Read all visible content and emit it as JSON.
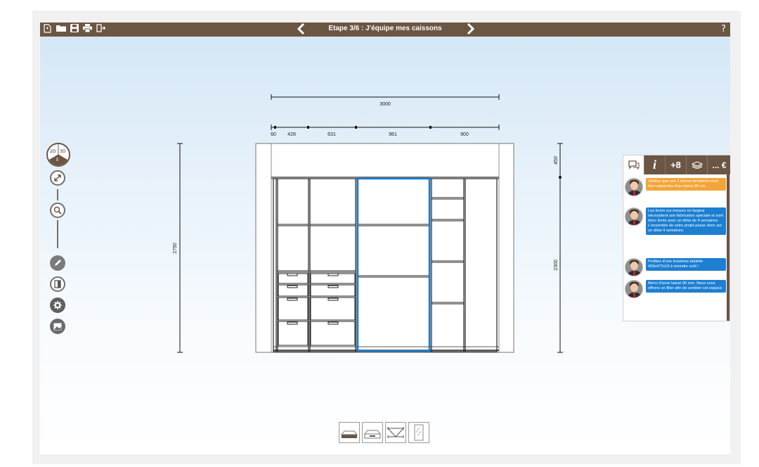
{
  "topbar": {
    "title": "Etape 3/6 : J'équipe mes caissons",
    "prev_icon": "chevron-left-icon",
    "next_icon": "chevron-right-icon",
    "help_label": "?",
    "file_icons": [
      "new-file-icon",
      "open-folder-icon",
      "save-icon",
      "print-icon",
      "exit-icon"
    ]
  },
  "tools": {
    "view_modes": {
      "mode_2d": "2D",
      "mode_3d": "3D",
      "mode_e": "E"
    },
    "items": [
      "view-mode-selector",
      "fit-view-icon",
      "zoom-icon",
      "pencil-icon",
      "door-icon",
      "settings-gear-icon",
      "photo-icon"
    ]
  },
  "dimensions": {
    "total_width": "3000",
    "segments": [
      "60",
      "428",
      "631",
      "981",
      "900"
    ],
    "total_height": "2750",
    "top_height": "450",
    "lower_height": "2300"
  },
  "panel": {
    "tabs": [
      {
        "icon": "chat-icon",
        "label": ""
      },
      {
        "icon": "info-icon",
        "label": "i"
      },
      {
        "icon": "add-user-icon",
        "label": "+8"
      },
      {
        "icon": "money-icon",
        "label": ""
      },
      {
        "icon": "price-icon",
        "label": "... €"
      }
    ],
    "messages": [
      {
        "color": "orange",
        "text": "Vérifiez que vos 2 barres penderies sont bien espacées d'au moins 90 cm."
      },
      {
        "color": "blue",
        "text": "Les tiroirs sur-mesure en largeur nécessitent une fabrication spéciale et sont donc livrés avec un délai de 4 semaines. L'ensemble de votre projet passe donc sur un délai 4 semaines."
      },
      {
        "color": "blue",
        "text": "Profitez d'une troisième tablette 409x472x19 à moindre coût !"
      },
      {
        "color": "blue",
        "text": "Merci d'avoir laissé 60 mm. Nous vous offrons un filler afin de combler cet espace."
      }
    ]
  },
  "bottom_views": [
    "floor-view-icon",
    "drawer-view-icon",
    "rail-view-icon",
    "door-panel-view-icon"
  ],
  "colors": {
    "brand": "#6b5543",
    "selection": "#1c7fd1",
    "warning": "#f3a53a"
  }
}
